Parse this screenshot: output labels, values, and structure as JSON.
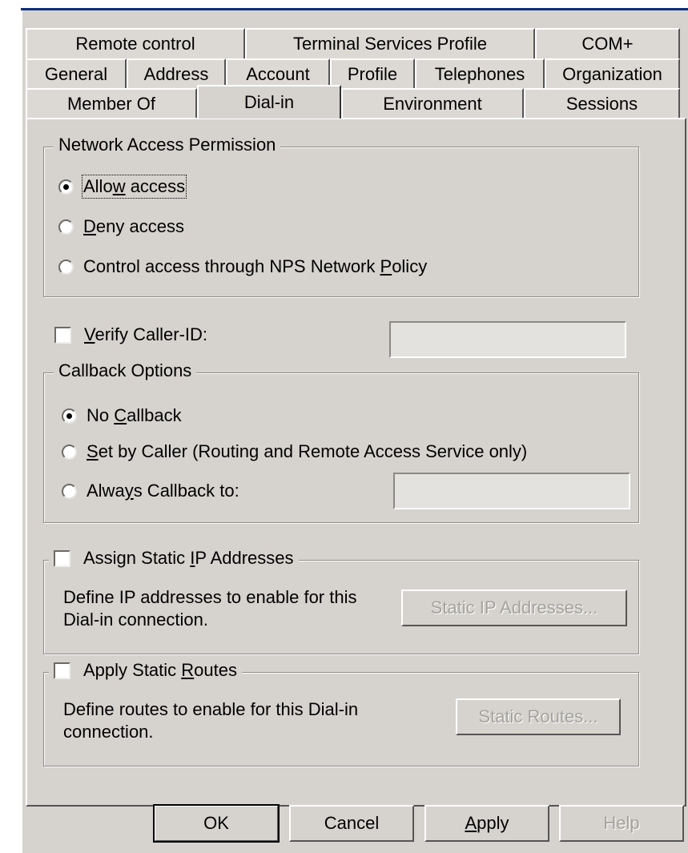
{
  "tabs": {
    "row1": [
      "Remote control",
      "Terminal Services Profile",
      "COM+"
    ],
    "row2": [
      "General",
      "Address",
      "Account",
      "Profile",
      "Telephones",
      "Organization"
    ],
    "row3": [
      "Member Of",
      "Dial-in",
      "Environment",
      "Sessions"
    ],
    "active": "Dial-in"
  },
  "network_access": {
    "legend": "Network Access Permission",
    "options": [
      {
        "pre": "Allo",
        "key": "w",
        "post": " access",
        "checked": true
      },
      {
        "pre": "",
        "key": "D",
        "post": "eny access",
        "checked": false
      },
      {
        "pre": "Control access through NPS Network ",
        "key": "P",
        "post": "olicy",
        "checked": false
      }
    ]
  },
  "verify_caller": {
    "pre": "",
    "key": "V",
    "post": "erify Caller-ID:",
    "checked": false,
    "value": ""
  },
  "callback": {
    "legend": "Callback Options",
    "options": [
      {
        "pre": "No ",
        "key": "C",
        "post": "allback",
        "checked": true
      },
      {
        "pre": "",
        "key": "S",
        "post": "et by Caller (Routing and Remote Access Service only)",
        "checked": false
      },
      {
        "pre": "Alwa",
        "key": "y",
        "post": "s Callback to:",
        "checked": false
      }
    ],
    "value": ""
  },
  "static_ip": {
    "pre": "Assign Static ",
    "key": "I",
    "post": "P Addresses",
    "checked": false,
    "desc_line1": "Define IP addresses to enable for this",
    "desc_line2": "Dial-in connection.",
    "button": "Static IP Addresses..."
  },
  "static_routes": {
    "pre": "Apply Static ",
    "key": "R",
    "post": "outes",
    "checked": false,
    "desc_line1": "Define routes to enable for this Dial-in",
    "desc_line2": "connection.",
    "button": "Static Routes..."
  },
  "buttons": {
    "ok": "OK",
    "cancel": "Cancel",
    "apply_key": "A",
    "apply_rest": "pply",
    "help": "Help"
  },
  "colors": {
    "dialog_bg": "#d6d3ce",
    "title_bar": "#0a2f7e"
  }
}
